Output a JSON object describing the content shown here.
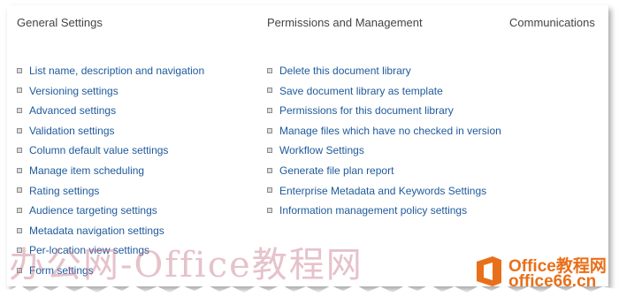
{
  "sections": {
    "general": {
      "title": "General Settings",
      "links": [
        "List name, description and navigation",
        "Versioning settings",
        "Advanced settings",
        "Validation settings",
        "Column default value settings",
        "Manage item scheduling",
        "Rating settings",
        "Audience targeting settings",
        "Metadata navigation settings",
        "Per-location view settings",
        "Form settings"
      ]
    },
    "permissions": {
      "title": "Permissions and Management",
      "links": [
        "Delete this document library",
        "Save document library as template",
        "Permissions for this document library",
        "Manage files which have no checked in version",
        "Workflow Settings",
        "Generate file plan report",
        "Enterprise Metadata and Keywords Settings",
        "Information management policy settings"
      ]
    },
    "communications": {
      "title": "Communications"
    }
  },
  "watermark": {
    "text": "办公网-Office教程网",
    "logo_line1": "Office教程网",
    "logo_line2": "office66.cn"
  },
  "colors": {
    "link": "#1e5a9c",
    "heading": "#444444",
    "watermark": "#c8788c",
    "logo": "#e8701a"
  }
}
